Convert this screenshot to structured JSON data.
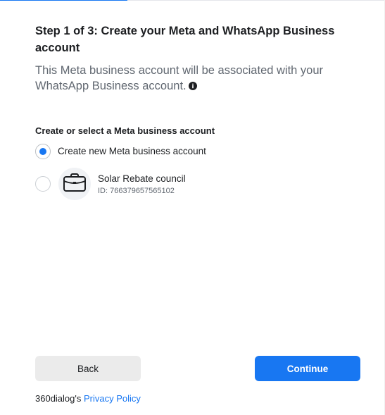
{
  "header": {
    "progress_percent": 33,
    "title": "Step 1 of 3: Create your Meta and WhatsApp Business account",
    "subtitle": "This Meta business account will be associated with your WhatsApp Business account."
  },
  "selection": {
    "label": "Create or select a Meta business account",
    "options": [
      {
        "label": "Create new Meta business account",
        "selected": true
      },
      {
        "name": "Solar Rebate council",
        "id_text": "ID: 766379657565102",
        "icon": "briefcase-icon",
        "selected": false
      }
    ]
  },
  "buttons": {
    "back_label": "Back",
    "continue_label": "Continue"
  },
  "footer": {
    "prefix": "360dialog's ",
    "link_label": "Privacy Policy"
  },
  "colors": {
    "accent": "#1877f2",
    "back_button_bg": "#ebebeb",
    "subtitle_text": "#606770"
  }
}
